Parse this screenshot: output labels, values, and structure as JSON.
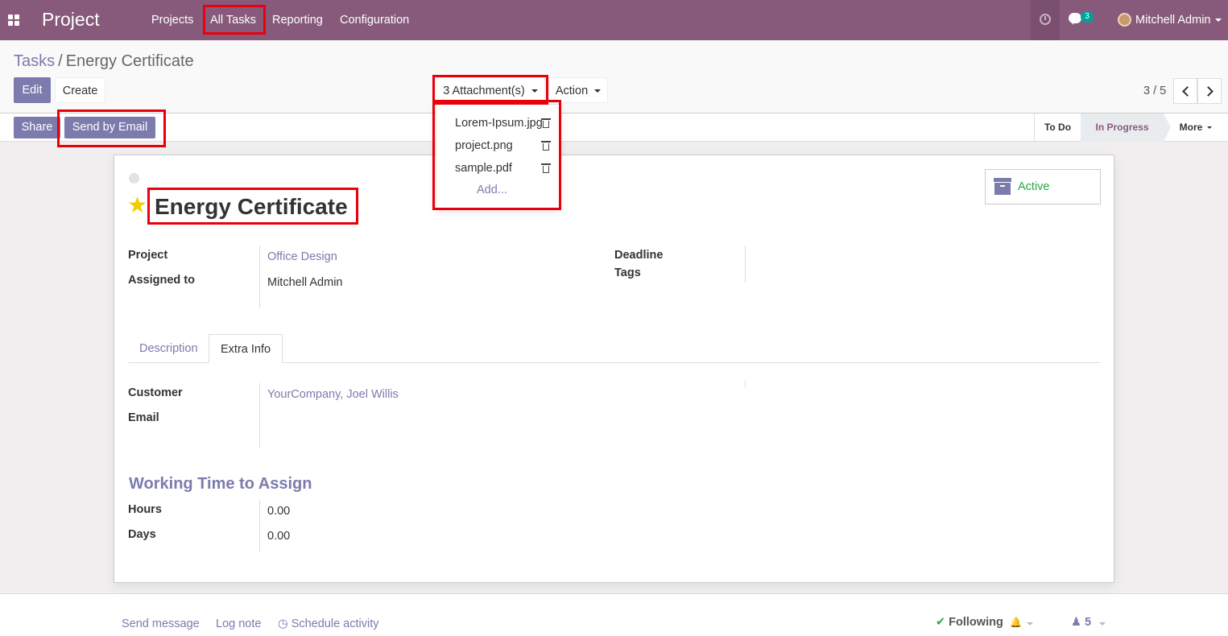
{
  "topbar": {
    "app_title": "Project",
    "menu": [
      "Projects",
      "All Tasks",
      "Reporting",
      "Configuration"
    ],
    "chat_count": "3",
    "user_name": "Mitchell Admin"
  },
  "breadcrumb": {
    "parent": "Tasks",
    "separator": "/",
    "current": "Energy Certificate"
  },
  "buttons": {
    "edit": "Edit",
    "create": "Create",
    "attachments": "3 Attachment(s)",
    "action": "Action",
    "share": "Share",
    "send_by_email": "Send by Email"
  },
  "pager": {
    "value": "3 / 5"
  },
  "stages": {
    "todo": "To Do",
    "in_progress": "In Progress",
    "more": "More"
  },
  "attachments_dropdown": {
    "items": [
      "Lorem-Ipsum.jpg",
      "project.png",
      "sample.pdf"
    ],
    "add_label": "Add..."
  },
  "task": {
    "title": "Energy Certificate",
    "active_label": "Active",
    "fields": {
      "project_label": "Project",
      "project_value": "Office Design",
      "assigned_label": "Assigned to",
      "assigned_value": "Mitchell Admin",
      "deadline_label": "Deadline",
      "tags_label": "Tags"
    },
    "tabs": [
      "Description",
      "Extra Info"
    ],
    "extra_info": {
      "customer_label": "Customer",
      "customer_value": "YourCompany, Joel Willis",
      "email_label": "Email"
    },
    "working_time": {
      "title": "Working Time to Assign",
      "hours_label": "Hours",
      "hours_value": "0.00",
      "days_label": "Days",
      "days_value": "0.00"
    }
  },
  "chatter": {
    "send_message": "Send message",
    "log_note": "Log note",
    "schedule_activity": "Schedule activity",
    "following": "Following",
    "followers_count": "5"
  },
  "colors": {
    "brand": "#875a7b",
    "primary": "#7c7bad",
    "active_green": "#28a745",
    "highlight_red": "#e8000b"
  }
}
